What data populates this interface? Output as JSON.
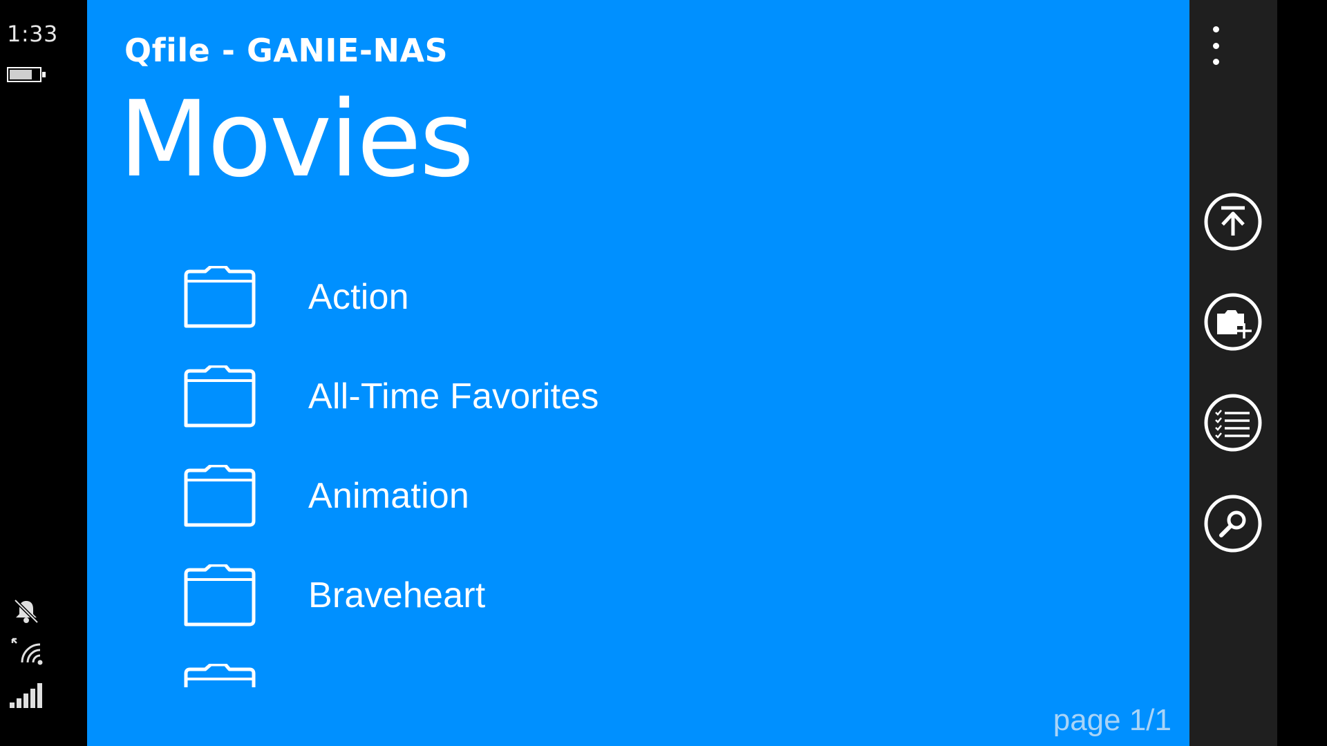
{
  "status": {
    "time": "1:33",
    "icons": [
      "battery-icon",
      "bell-mute-icon",
      "wifi-icon",
      "signal-icon"
    ]
  },
  "app": {
    "title": "Qfile - GANIE-NAS",
    "page_title": "Movies",
    "page_indicator": "page 1/1"
  },
  "folders": [
    {
      "label": "Action",
      "icon": "folder-icon"
    },
    {
      "label": "All-Time Favorites",
      "icon": "folder-icon"
    },
    {
      "label": "Animation",
      "icon": "folder-icon"
    },
    {
      "label": "Braveheart",
      "icon": "folder-icon"
    }
  ],
  "app_bar": {
    "buttons": [
      "upload-icon",
      "new-folder-icon",
      "select-list-icon",
      "search-icon"
    ],
    "more": "more-options-icon"
  },
  "colors": {
    "accent": "#0090ff",
    "app_bar": "#1f1f1f",
    "page_indicator": "#a9d4f7"
  }
}
